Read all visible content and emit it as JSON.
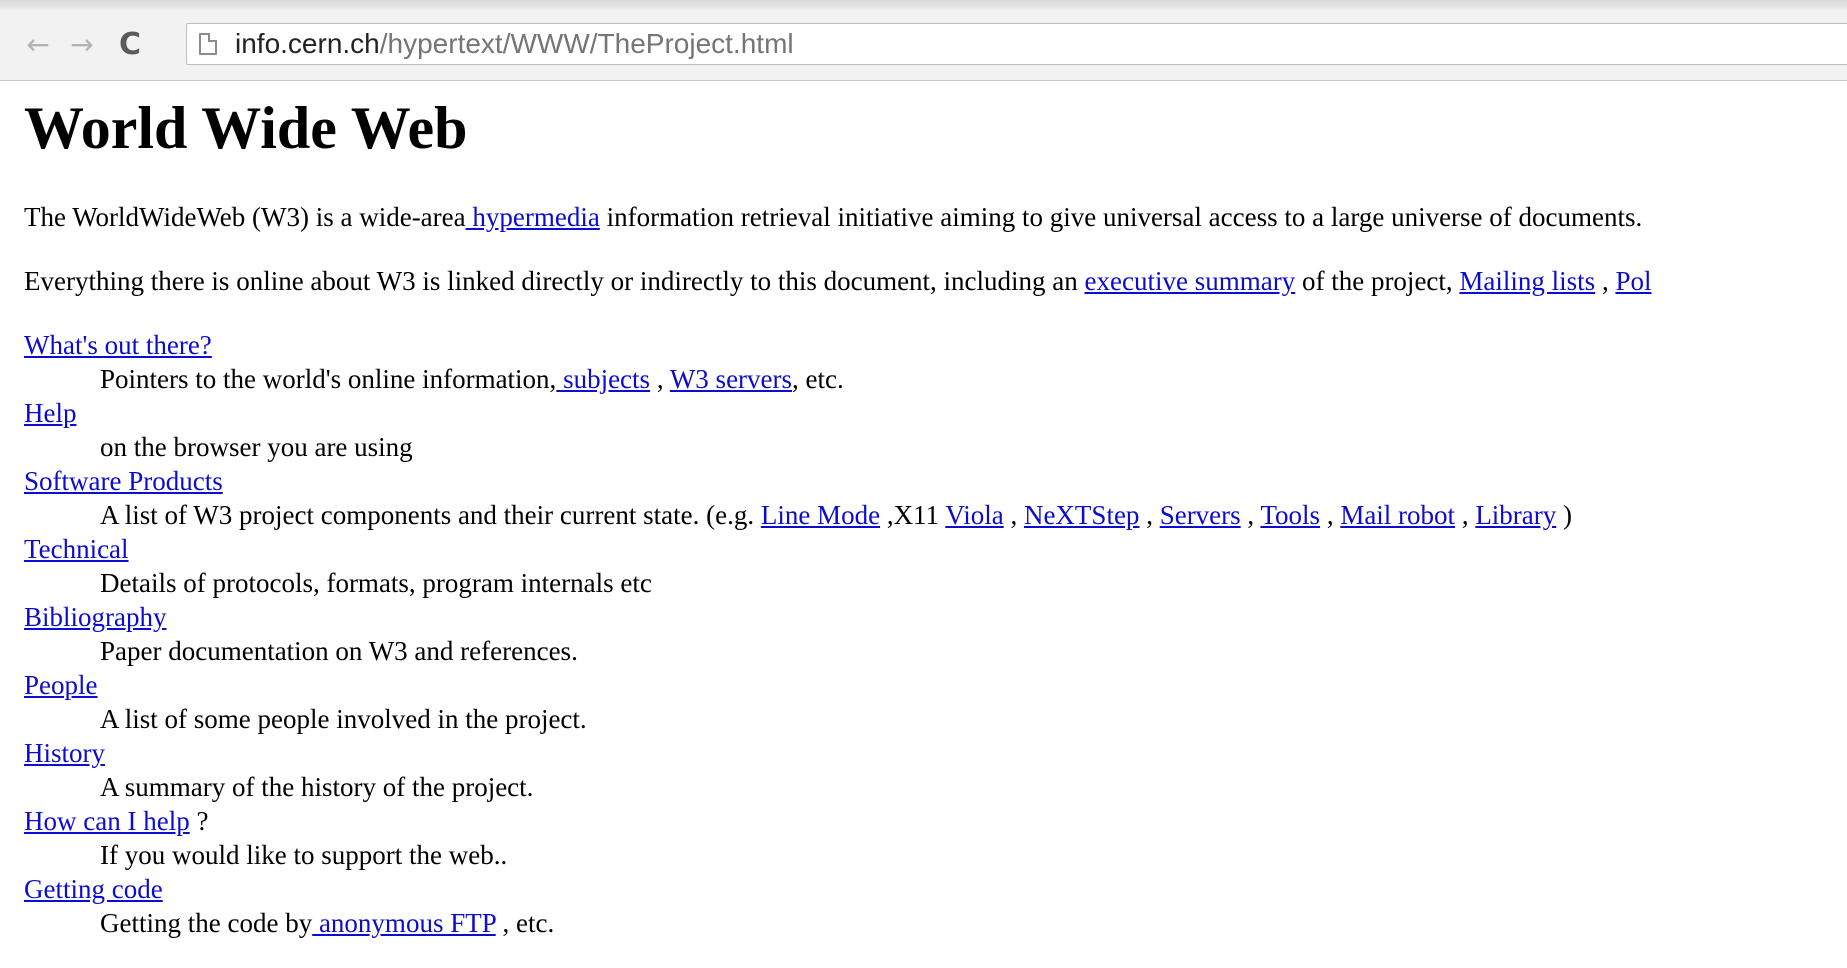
{
  "browser": {
    "url_host": "info.cern.ch",
    "url_path": "/hypertext/WWW/TheProject.html",
    "icons": {
      "back": "back-arrow-icon",
      "forward": "forward-arrow-icon",
      "reload": "reload-icon",
      "page": "page-icon"
    }
  },
  "page": {
    "title": "World Wide Web",
    "intro1": {
      "before": "The WorldWideWeb (W3) is a wide-area",
      "link": " hypermedia",
      "after": " information retrieval initiative aiming to give universal access to a large universe of documents."
    },
    "intro2": {
      "before": "Everything there is online about W3 is linked directly or indirectly to this document, including an ",
      "link1": "executive summary",
      "mid": " of the project, ",
      "link2": "Mailing lists",
      "sep": " , ",
      "link3": "Pol"
    },
    "items": [
      {
        "term": "What's out there?",
        "desc_before": "Pointers to the world's online information,",
        "desc_link1": " subjects",
        "desc_sep": " , ",
        "desc_link2": "W3 servers",
        "desc_after": ", etc."
      },
      {
        "term": "Help",
        "desc": "on the browser you are using"
      },
      {
        "term": "Software Products",
        "desc_before": "A list of W3 project components and their current state. (e.g. ",
        "links": [
          "Line Mode",
          "Viola",
          "NeXTStep",
          "Servers",
          "Tools",
          " Mail robot",
          " Library"
        ],
        "x11": " ,X11 ",
        "sep": " , ",
        "close": " )"
      },
      {
        "term": "Technical",
        "desc": "Details of protocols, formats, program internals etc"
      },
      {
        "term": "Bibliography",
        "desc": "Paper documentation on W3 and references."
      },
      {
        "term": "People",
        "desc": "A list of some people involved in the project."
      },
      {
        "term": "History",
        "desc": "A summary of the history of the project."
      },
      {
        "term": "How can I help",
        "term_suffix": " ?",
        "desc": "If you would like to support the web.."
      },
      {
        "term": "Getting code",
        "desc_before": "Getting the code by",
        "desc_link": " anonymous FTP",
        "desc_after": " , etc."
      }
    ]
  },
  "colors": {
    "link": "#0b0bd1",
    "toolbar_bg": "#f2f2f2",
    "page_bg": "#ffffff"
  }
}
